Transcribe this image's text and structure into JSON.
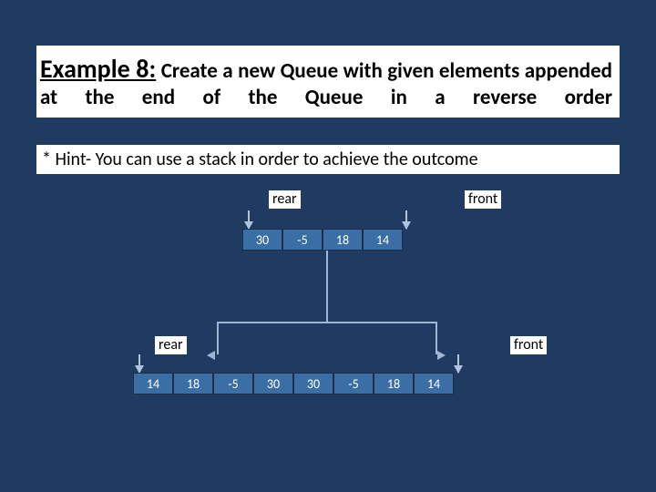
{
  "header": {
    "title_strong": "Example 8:",
    "title_rest": " Create a new Queue with given elements appended at the end of the Queue in a reverse order"
  },
  "hint": "* Hint- You can use a stack in order to achieve the outcome",
  "labels": {
    "rear": "rear",
    "front": "front"
  },
  "queue_top": [
    "30",
    "-5",
    "18",
    "14"
  ],
  "queue_bottom": [
    "14",
    "18",
    "-5",
    "30",
    "30",
    "-5",
    "18",
    "14"
  ]
}
